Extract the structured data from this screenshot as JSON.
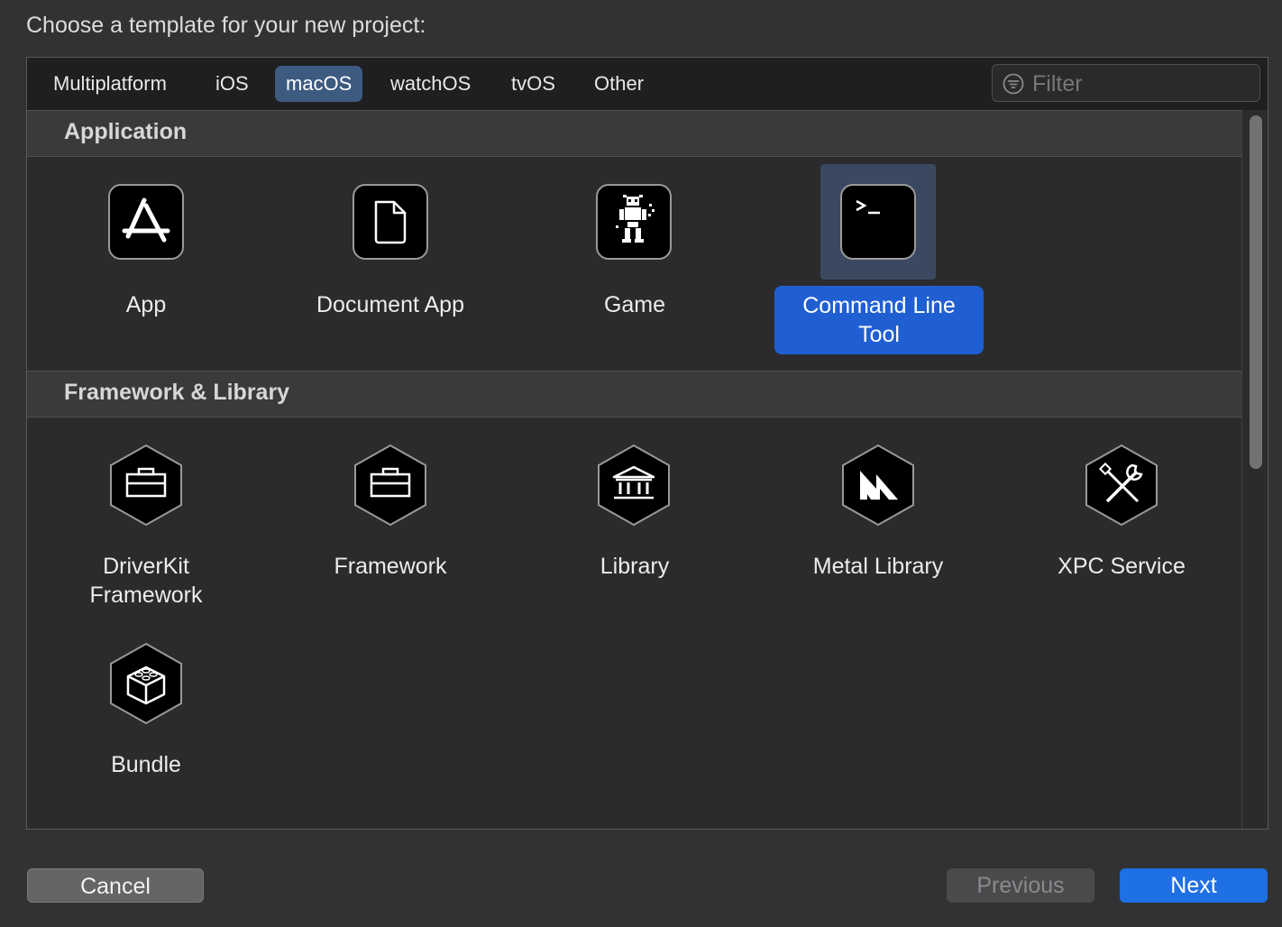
{
  "prompt": "Choose a template for your new project:",
  "tabs": [
    "Multiplatform",
    "iOS",
    "macOS",
    "watchOS",
    "tvOS",
    "Other"
  ],
  "active_tab": "macOS",
  "filter": {
    "placeholder": "Filter",
    "value": ""
  },
  "sections": [
    {
      "title": "Application",
      "items": [
        {
          "label": "App",
          "icon": "app-store-icon"
        },
        {
          "label": "Document App",
          "icon": "document-icon"
        },
        {
          "label": "Game",
          "icon": "game-robot-icon"
        },
        {
          "label": "Command Line Tool",
          "icon": "terminal-icon",
          "selected": true
        }
      ]
    },
    {
      "title": "Framework & Library",
      "items": [
        {
          "label": "DriverKit Framework",
          "icon": "toolbox-icon"
        },
        {
          "label": "Framework",
          "icon": "toolbox-icon"
        },
        {
          "label": "Library",
          "icon": "library-building-icon"
        },
        {
          "label": "Metal Library",
          "icon": "metal-icon"
        },
        {
          "label": "XPC Service",
          "icon": "tools-icon"
        },
        {
          "label": "Bundle",
          "icon": "cube-bundle-icon"
        }
      ]
    }
  ],
  "buttons": {
    "cancel": "Cancel",
    "previous": "Previous",
    "next": "Next"
  },
  "colors": {
    "accent": "#1f6fe5",
    "selection": "#1f5fd1",
    "active_tab": "#3d5a80"
  }
}
